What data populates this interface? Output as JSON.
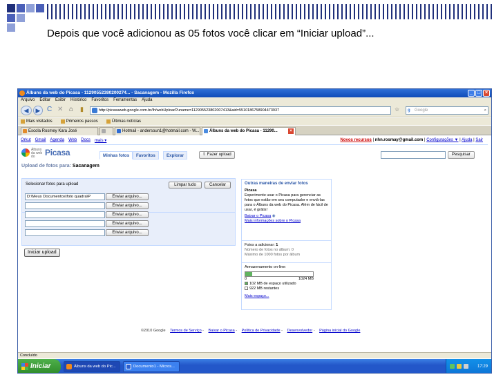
{
  "slide": {
    "title": "Depois que você adicionou as 05 fotos você clicar em “Iniciar upload”..."
  },
  "browser": {
    "window_title": "Álbuns da web do Picasa - 11290552380200274... - Sacanagem - Mozilla Firefox",
    "menu": [
      "Arquivo",
      "Editar",
      "Exibir",
      "Histórico",
      "Favoritos",
      "Ferramentas",
      "Ajuda"
    ],
    "url": "http://picasaweb.google.com.br/lh/webUpload?uname=112905523802007413&aid=5510186758904473937",
    "search_placeholder": "Google",
    "bookmarks": [
      "Mais visitados",
      "Primeiros passos",
      "Últimas notícias"
    ],
    "tabs": [
      {
        "label": "Escola Rosmey Kara José"
      },
      {
        "label": ""
      },
      {
        "label": "Hotmail - andersoun1@hotmail.com - W..."
      },
      {
        "label": "Álbuns da web do Picasa - 11290..."
      }
    ],
    "status": "Concluído"
  },
  "google_bar": {
    "links": [
      "Orkut",
      "Gmail",
      "Agenda",
      "Web",
      "Docs",
      "mais ▾"
    ],
    "novos_recursos": "Novos recursos",
    "email": "nhn.rosmay@gmail.com",
    "links_right": [
      "Configurações ▼",
      "Ajuda",
      "Sair"
    ]
  },
  "picasa": {
    "logo_small": "Álbuns da web do",
    "logo": "Picasa",
    "tabs": [
      "Minhas fotos",
      "Favoritos",
      "Explorar"
    ],
    "upload_button": "Fazer upload",
    "search_button": "Pesquisar",
    "upload_label": "Upload de fotos para:",
    "album": "Sacanagem",
    "select_label": "Selecionar fotos para upload",
    "clear_button": "Limpar tudo",
    "cancel_button": "Cancelar",
    "file_rows": [
      {
        "value": "D:\\Meus Documentos\\foto quadra\\P",
        "button": "Enviar arquivo..."
      },
      {
        "value": "",
        "button": "Enviar arquivo..."
      },
      {
        "value": "",
        "button": "Enviar arquivo..."
      },
      {
        "value": "",
        "button": "Enviar arquivo..."
      },
      {
        "value": "",
        "button": "Enviar arquivo..."
      }
    ],
    "start_button": "Iniciar upload",
    "other_ways": {
      "title": "Outras maneiras de enviar fotos",
      "subtitle": "Picasa",
      "text": "Experimente usar o Picasa para gerenciar as fotos que estão em seu computador e enviá-las para o Álbuns da web do Picasa. Além de fácil de usar, é grátis!",
      "link1": "Baixar o Picasa",
      "link2": "Mais informações sobre o Picasa"
    },
    "counts": {
      "added_label": "Fotos a adicionar:",
      "added_value": "1",
      "in_album": "Número de fotos no álbum: 0",
      "max": "Máximo de 1000 fotos por álbum"
    },
    "storage": {
      "title": "Armazenamento on-line:",
      "used_fraction": 0.1,
      "min_label": "0",
      "max_label": "1024 MB",
      "used_text": "102 MB de espaço utilizado",
      "free_text": "922 MB restantes",
      "more_link": "Mais espaço..."
    },
    "footer": {
      "copyright": "©2010 Google",
      "links": [
        "Termos de Serviço",
        "Baixar o Picasa",
        "Política de Privacidade",
        "Desenvolvedor",
        "Página inicial do Google"
      ]
    }
  },
  "taskbar": {
    "start": "Iniciar",
    "tasks": [
      "Álbuns da web do Pic...",
      "Documento1 - Micros..."
    ],
    "clock": "17:29"
  },
  "colors": {
    "titlebar": "#0f4bb8",
    "link": "#0000cc",
    "panel": "#e8eefa",
    "taskbar": "#2357c9",
    "start": "#2e8a2a"
  }
}
